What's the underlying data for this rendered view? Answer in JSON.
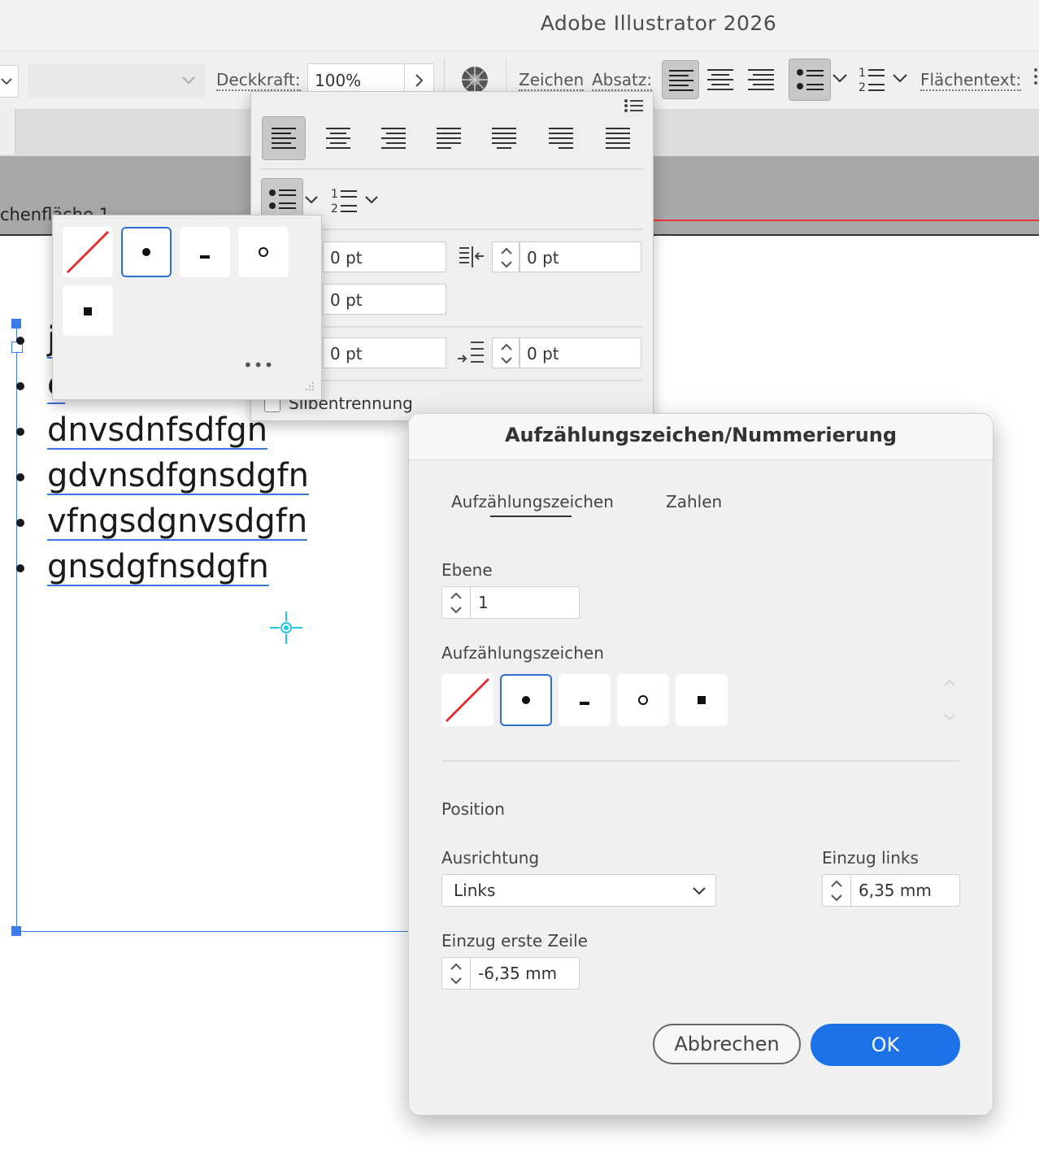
{
  "app": {
    "title": "Adobe Illustrator 2026"
  },
  "controlbar": {
    "opacity_label": "Deckkraft:",
    "opacity_value": "100%",
    "character_label": "Zeichen",
    "paragraph_label": "Absatz:",
    "area_text_label": "Flächentext:"
  },
  "artboard": {
    "label": "chenfläche 1",
    "text_lines": [
      {
        "text": "j"
      },
      {
        "text": "c"
      },
      {
        "text": "dnvsdnfsdfgn"
      },
      {
        "text": "gdvnsdfgnsdgfn"
      },
      {
        "text": "vfngsdgnvsdgfn"
      },
      {
        "text": "gnsdgfnsdgfn"
      }
    ]
  },
  "paragraph_panel": {
    "fields": {
      "left_indent": "0 pt",
      "right_indent": "0 pt",
      "first_line_indent": "0 pt",
      "space_before": "0 pt",
      "space_after": "0 pt"
    },
    "hyphenation_label": "Silbentrennung"
  },
  "bullet_popover": {
    "options": [
      "none",
      "bullet",
      "dash",
      "circle",
      "square"
    ],
    "selected": "bullet",
    "more_label": "•••"
  },
  "dialog": {
    "title": "Aufzählungszeichen/Nummerierung",
    "tabs": [
      {
        "label": "Aufzählungszeichen",
        "active": true
      },
      {
        "label": "Zahlen",
        "active": false
      }
    ],
    "level_label": "Ebene",
    "level_value": "1",
    "bullet_label": "Aufzählungszeichen",
    "bullet_options": [
      "none",
      "bullet",
      "dash",
      "circle",
      "square"
    ],
    "bullet_selected": "bullet",
    "position_label": "Position",
    "alignment_label": "Ausrichtung",
    "alignment_value": "Links",
    "left_indent_label": "Einzug links",
    "left_indent_value": "6,35 mm",
    "first_line_label": "Einzug erste Zeile",
    "first_line_value": "-6,35 mm",
    "cancel_label": "Abbrechen",
    "ok_label": "OK"
  },
  "colors": {
    "accent": "#1b72e8",
    "selection": "#3b7be8",
    "none_slash": "#e03030"
  }
}
